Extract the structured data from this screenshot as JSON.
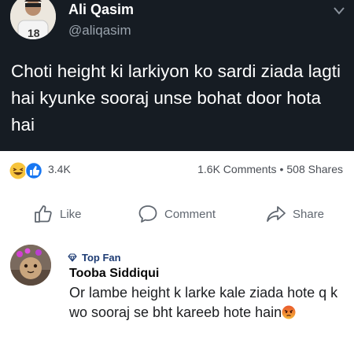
{
  "post": {
    "author_name": "Ali Qasim",
    "author_handle": "@aliqasim",
    "text": "Choti height ki larkiyon ko sardi ziada lagti hai kyunke sooraj unse bohat door hota hai",
    "background": "#161c23"
  },
  "stats": {
    "reaction_icons": [
      "haha-emoji",
      "like-emoji"
    ],
    "reaction_count": "3.4K",
    "comments": "1.6K Comments",
    "separator": "•",
    "shares": "508 Shares"
  },
  "actions": {
    "like": "Like",
    "comment": "Comment",
    "share": "Share"
  },
  "comment": {
    "badge": "Top Fan",
    "name": "Tooba Siddiqui",
    "text": "Or lambe height k larke kale ziada hote q k wo sooraj se bht kareeb hote hain",
    "emoji": "angry-emoji"
  }
}
